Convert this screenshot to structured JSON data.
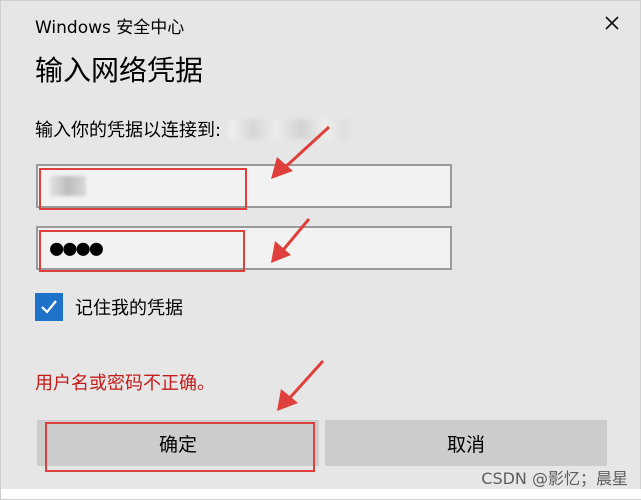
{
  "window": {
    "title": "Windows 安全中心",
    "close_symbol": "✕"
  },
  "dialog": {
    "heading": "输入网络凭据",
    "prompt": "输入你的凭据以连接到:",
    "username_value": "",
    "password_masked": "●●●●",
    "remember_label": "记住我的凭据",
    "remember_checked": true,
    "error_message": "用户名或密码不正确。",
    "ok_label": "确定",
    "cancel_label": "取消"
  },
  "colors": {
    "checkbox": "#1f72c9",
    "error": "#c51b1b",
    "annotation": "#e0403c"
  },
  "icons": {
    "close": "close-icon",
    "check": "checkmark-icon",
    "arrow": "red-annotation-arrow"
  },
  "watermark": "CSDN @影忆；晨星"
}
